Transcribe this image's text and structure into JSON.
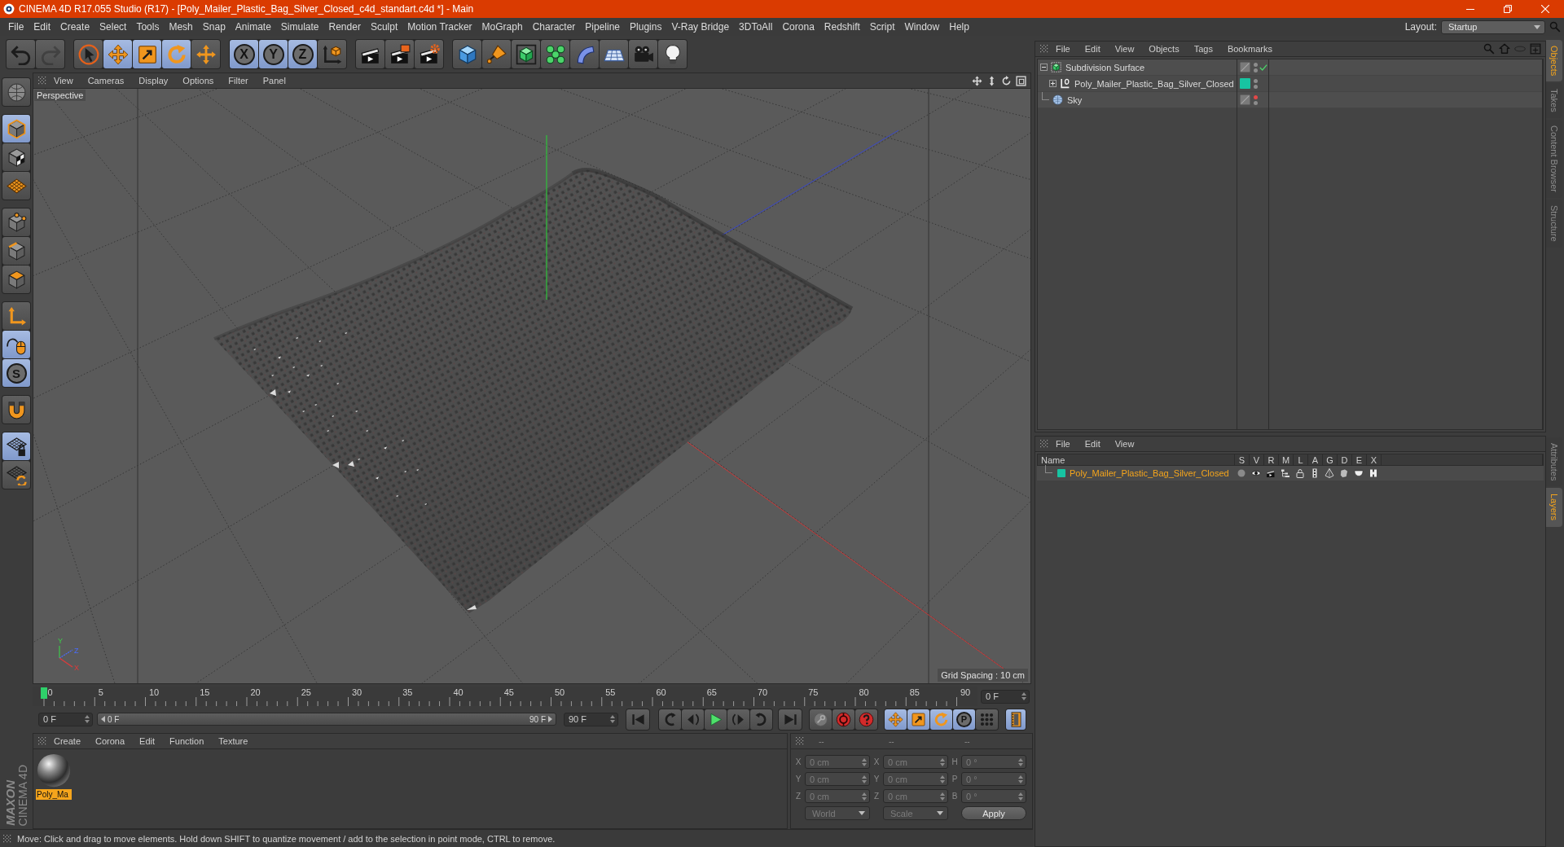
{
  "window": {
    "title": "CINEMA 4D R17.055 Studio (R17) - [Poly_Mailer_Plastic_Bag_Silver_Closed_c4d_standart.c4d *] - Main"
  },
  "menu_bar": {
    "items": [
      "File",
      "Edit",
      "Create",
      "Select",
      "Tools",
      "Mesh",
      "Snap",
      "Animate",
      "Simulate",
      "Render",
      "Sculpt",
      "Motion Tracker",
      "MoGraph",
      "Character",
      "Pipeline",
      "Plugins",
      "V-Ray Bridge",
      "3DToAll",
      "Corona",
      "Redshift",
      "Script",
      "Window",
      "Help"
    ],
    "layout_label": "Layout:",
    "layout_value": "Startup"
  },
  "toolbar": {
    "groups": [
      [
        {
          "selected": false,
          "disabled": false
        },
        {
          "selected": false,
          "disabled": true
        }
      ],
      [
        {
          "selected": false,
          "disabled": false
        },
        {
          "selected": true,
          "disabled": false
        },
        {
          "selected": true,
          "disabled": false
        },
        {
          "selected": true,
          "disabled": false
        },
        {
          "selected": false,
          "disabled": false
        }
      ],
      [
        {
          "label": "X",
          "selected": true,
          "disabled": false
        },
        {
          "label": "Y",
          "selected": true,
          "disabled": false
        },
        {
          "label": "Z",
          "selected": true,
          "disabled": false
        },
        {
          "selected": false,
          "disabled": false
        }
      ],
      [
        {
          "selected": false,
          "disabled": false
        },
        {
          "selected": false,
          "disabled": false
        },
        {
          "selected": false,
          "disabled": false
        }
      ],
      [
        {
          "selected": false,
          "disabled": false
        },
        {
          "selected": false,
          "disabled": false
        },
        {
          "selected": false,
          "disabled": false
        },
        {
          "selected": false,
          "disabled": false
        },
        {
          "selected": false,
          "disabled": false
        },
        {
          "selected": false,
          "disabled": false
        },
        {
          "selected": false,
          "disabled": false
        },
        {
          "selected": false,
          "disabled": false
        }
      ]
    ]
  },
  "palette": {
    "groups": [
      [
        {
          "selected": false
        }
      ],
      [
        {
          "selected": true
        },
        {
          "selected": false
        },
        {
          "selected": false
        }
      ],
      [
        {
          "selected": false
        },
        {
          "selected": false
        },
        {
          "selected": false
        }
      ],
      [
        {
          "selected": false
        },
        {
          "selected": true
        },
        {
          "label": "S",
          "selected": true
        }
      ],
      [
        {
          "selected": false
        }
      ],
      [
        {
          "selected": true
        },
        {
          "selected": false
        }
      ]
    ]
  },
  "brand": {
    "name": "MAXON",
    "product": "CINEMA 4D"
  },
  "viewport": {
    "menu": [
      "View",
      "Cameras",
      "Display",
      "Options",
      "Filter",
      "Panel"
    ],
    "camera": "Perspective",
    "grid_spacing": "Grid Spacing : 10 cm",
    "axis_labels": [
      "Y",
      "Z",
      "X"
    ]
  },
  "timeline": {
    "ticks": [
      "0",
      "5",
      "10",
      "15",
      "20",
      "25",
      "30",
      "35",
      "40",
      "45",
      "50",
      "55",
      "60",
      "65",
      "70",
      "75",
      "80",
      "85",
      "90"
    ],
    "playhead": {
      "level": 0
    },
    "current_frame": "0 F"
  },
  "range": {
    "start_field": "0 F",
    "preview_range": {
      "start": "0 F",
      "end": "90 F"
    },
    "end_field": "90 F"
  },
  "key_toggles": [
    {
      "selected": true
    },
    {
      "selected": true
    },
    {
      "selected": true
    },
    {
      "label": "P",
      "selected": true
    },
    {
      "selected": false
    }
  ],
  "timeline_toggle": {
    "selected": true
  },
  "materials": {
    "menu": [
      "Create",
      "Corona",
      "Edit",
      "Function",
      "Texture"
    ],
    "items": [
      {
        "name": "Poly_Ma",
        "selected": true
      }
    ]
  },
  "coordinates": {
    "disabled": true,
    "headers": [
      "--",
      "--",
      "--"
    ],
    "rows": [
      {
        "cells": [
          {
            "axis": "X",
            "value": "0 cm"
          },
          {
            "axis": "X",
            "value": "0 cm"
          },
          {
            "axis": "H",
            "value": "0 °"
          }
        ]
      },
      {
        "cells": [
          {
            "axis": "Y",
            "value": "0 cm"
          },
          {
            "axis": "Y",
            "value": "0 cm"
          },
          {
            "axis": "P",
            "value": "0 °"
          }
        ]
      },
      {
        "cells": [
          {
            "axis": "Z",
            "value": "0 cm"
          },
          {
            "axis": "Z",
            "value": "0 cm"
          },
          {
            "axis": "B",
            "value": "0 °"
          }
        ]
      }
    ],
    "dropdowns": [
      "World",
      "Scale"
    ],
    "apply": "Apply"
  },
  "status_bar": {
    "text": "Move: Click and drag to move elements. Hold down SHIFT to quantize movement / add to the selection in point mode, CTRL to remove."
  },
  "objects": {
    "menu": [
      "File",
      "Edit",
      "View",
      "Objects",
      "Tags",
      "Bookmarks"
    ],
    "tree": [
      {
        "kind": "subdivision",
        "name": "Subdivision Surface",
        "selected": false,
        "expanded": true,
        "editor_hidden": false,
        "render_hidden": false,
        "check": true,
        "children": [
          {
            "kind": "polygon",
            "name": "Poly_Mailer_Plastic_Bag_Silver_Closed",
            "selected": false,
            "expanded": false,
            "color": "#17c4a2",
            "editor_hidden": false,
            "render_hidden": false,
            "check": false
          }
        ]
      },
      {
        "kind": "sky",
        "name": "Sky",
        "selected": false,
        "editor_hidden": true,
        "render_hidden": false,
        "check": false
      }
    ]
  },
  "layers": {
    "menu": [
      "File",
      "Edit",
      "View"
    ],
    "columns": [
      "Name",
      "S",
      "V",
      "R",
      "M",
      "L",
      "A",
      "G",
      "D",
      "E",
      "X"
    ],
    "rows": [
      {
        "name": "Poly_Mailer_Plastic_Bag_Silver_Closed",
        "color": "#17c4a2",
        "selected": true
      }
    ]
  },
  "side_tabs": {
    "upper": [
      {
        "label": "Objects",
        "selected": true
      },
      {
        "label": "Takes",
        "selected": false
      },
      {
        "label": "Content Browser",
        "selected": false
      },
      {
        "label": "Structure",
        "selected": false
      }
    ],
    "lower": [
      {
        "label": "Attributes",
        "selected": false
      },
      {
        "label": "Layers",
        "selected": true
      }
    ]
  }
}
